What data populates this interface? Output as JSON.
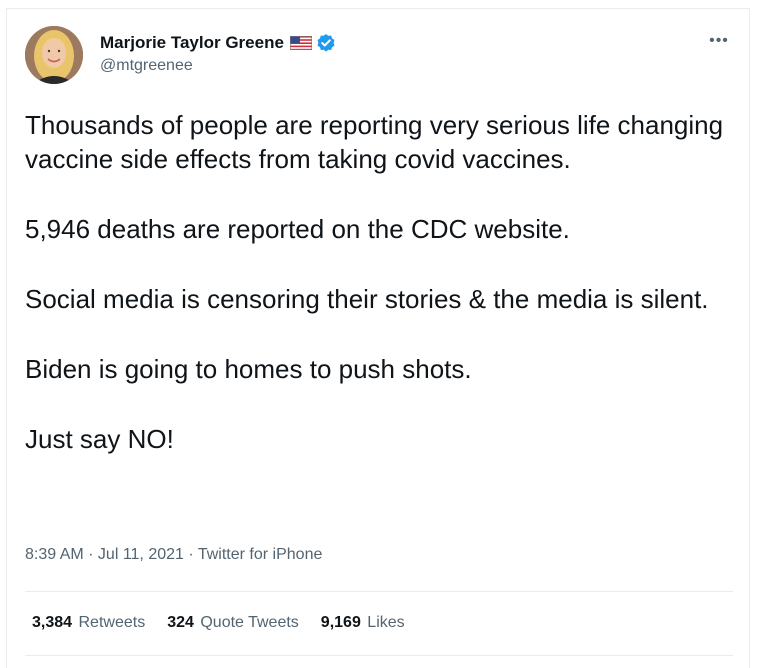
{
  "header": {
    "display_name": "Marjorie Taylor Greene",
    "handle": "@mtgreenee",
    "more": "•••",
    "icons": [
      "us-flag-icon",
      "verified-badge-icon",
      "more-icon"
    ]
  },
  "tweet": {
    "paragraphs": [
      "Thousands of people are reporting very serious life changing vaccine side effects from taking covid vaccines.",
      "5,946 deaths are reported on the CDC website.",
      "Social media is censoring their stories & the media is silent.",
      "Biden is going to homes to push shots.",
      "Just say NO!"
    ]
  },
  "meta": {
    "time": "8:39 AM",
    "sep1": " · ",
    "date": "Jul 11, 2021",
    "sep2": " · ",
    "source": "Twitter for iPhone"
  },
  "stats": {
    "retweets_count": "3,384",
    "retweets_label": "Retweets",
    "quotes_count": "324",
    "quotes_label": "Quote Tweets",
    "likes_count": "9,169",
    "likes_label": "Likes"
  },
  "colors": {
    "verified": "#1d9bf0",
    "secondary_text": "#536471",
    "primary_text": "#0f1419"
  }
}
